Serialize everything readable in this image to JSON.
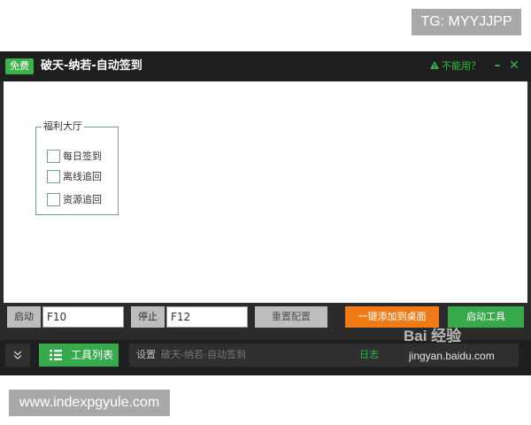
{
  "watermarks": {
    "top_tag": "TG: MYYJJPP",
    "bottom_site": "www.indexpgyule.com",
    "baidu_logo": "Bai 经验",
    "baidu_url": "jingyan.baidu.com"
  },
  "titlebar": {
    "badge": "免费",
    "title": "破天-纳若-自动签到",
    "help_label": "不能用？",
    "help_icon": "warning-icon",
    "minimize_label": "–",
    "close_label": "✕"
  },
  "group": {
    "legend": "福利大厅",
    "items": [
      {
        "label": "每日签到",
        "checked": false
      },
      {
        "label": "离线追回",
        "checked": false
      },
      {
        "label": "资源追回",
        "checked": false
      }
    ]
  },
  "controls": {
    "start_label": "启动",
    "start_hotkey": "F10",
    "stop_label": "停止",
    "stop_hotkey": "F12",
    "reset_button": "重置配置",
    "add_desktop_button": "一键添加到桌面",
    "start_tool_button": "启动工具"
  },
  "bottom": {
    "expand_icon": "double-chevron-down-icon",
    "tool_list_button": "工具列表",
    "status_prefix": "设置",
    "status_content": "破天-纳若-自动签到",
    "log_tab": "日志"
  },
  "colors": {
    "accent_green": "#36a94a",
    "accent_orange": "#f07a16",
    "dark_bg": "#1f1f1f"
  }
}
